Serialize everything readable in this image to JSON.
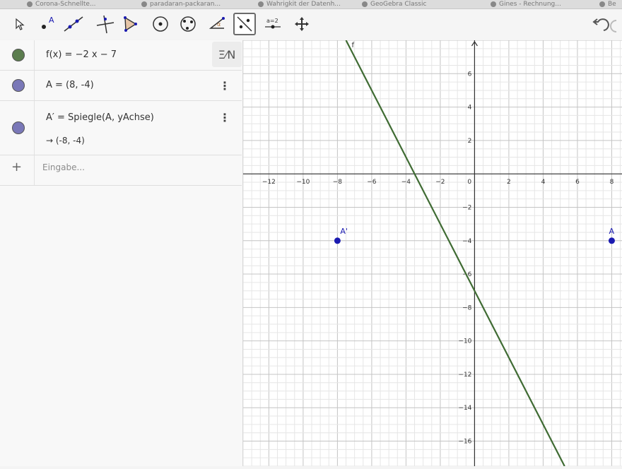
{
  "browser_tabs": [
    {
      "label": "Corona-Schnellte..."
    },
    {
      "label": "paradaran-packaran..."
    },
    {
      "label": "Wahrigkit der Datenh..."
    },
    {
      "label": "GeoGebra Classic"
    },
    {
      "label": "Gines - Rechnung..."
    },
    {
      "label": "Be"
    }
  ],
  "toolbar": {
    "tools": [
      {
        "id": "move",
        "icon": "cursor-arrow-icon"
      },
      {
        "id": "point",
        "icon": "point-icon",
        "label": "A"
      },
      {
        "id": "line",
        "icon": "line-through-points-icon"
      },
      {
        "id": "perpendicular",
        "icon": "perpendicular-line-icon"
      },
      {
        "id": "polygon",
        "icon": "polygon-icon"
      },
      {
        "id": "circle",
        "icon": "circle-center-point-icon"
      },
      {
        "id": "circle3",
        "icon": "circle-three-points-icon"
      },
      {
        "id": "angle",
        "icon": "angle-icon",
        "label": "α"
      },
      {
        "id": "reflect",
        "icon": "reflect-about-line-icon",
        "selected": true
      },
      {
        "id": "slider",
        "icon": "slider-icon",
        "label": "a=2"
      },
      {
        "id": "move-view",
        "icon": "move-graphics-view-icon"
      }
    ]
  },
  "algebra": {
    "rows": [
      {
        "name": "f",
        "text": "f(x)  =  −2 x − 7",
        "color": "#5b7d4e",
        "has_menu": false
      },
      {
        "name": "A",
        "text": "A  =  (8, -4)",
        "color": "#7a78b8",
        "has_menu": true
      },
      {
        "name": "A'",
        "text": "A′  =  Spiegle(A, yAchse)",
        "result": "→  (-8, -4)",
        "color": "#7a78b8",
        "has_menu": true
      }
    ],
    "input_placeholder": "Eingabe...",
    "plus": "+",
    "kebab": "⋮",
    "eq_button": "Ξ⁄N"
  },
  "graph": {
    "xlim": [
      -13.5,
      8.6
    ],
    "ylim": [
      -17.5,
      8.0
    ],
    "x_ticks": [
      -12,
      -10,
      -8,
      -6,
      -4,
      -2,
      0,
      2,
      4,
      6,
      8
    ],
    "y_ticks": [
      6,
      4,
      2,
      -2,
      -4,
      -6,
      -8,
      -10,
      -12,
      -14,
      -16
    ],
    "line": {
      "label": "f",
      "slope": -2,
      "intercept": -7,
      "color": "#3f6b33"
    },
    "points": [
      {
        "label": "A",
        "x": 8,
        "y": -4,
        "color": "#1a1ab0"
      },
      {
        "label": "A'",
        "x": -8,
        "y": -4,
        "color": "#1a1ab0"
      }
    ]
  }
}
